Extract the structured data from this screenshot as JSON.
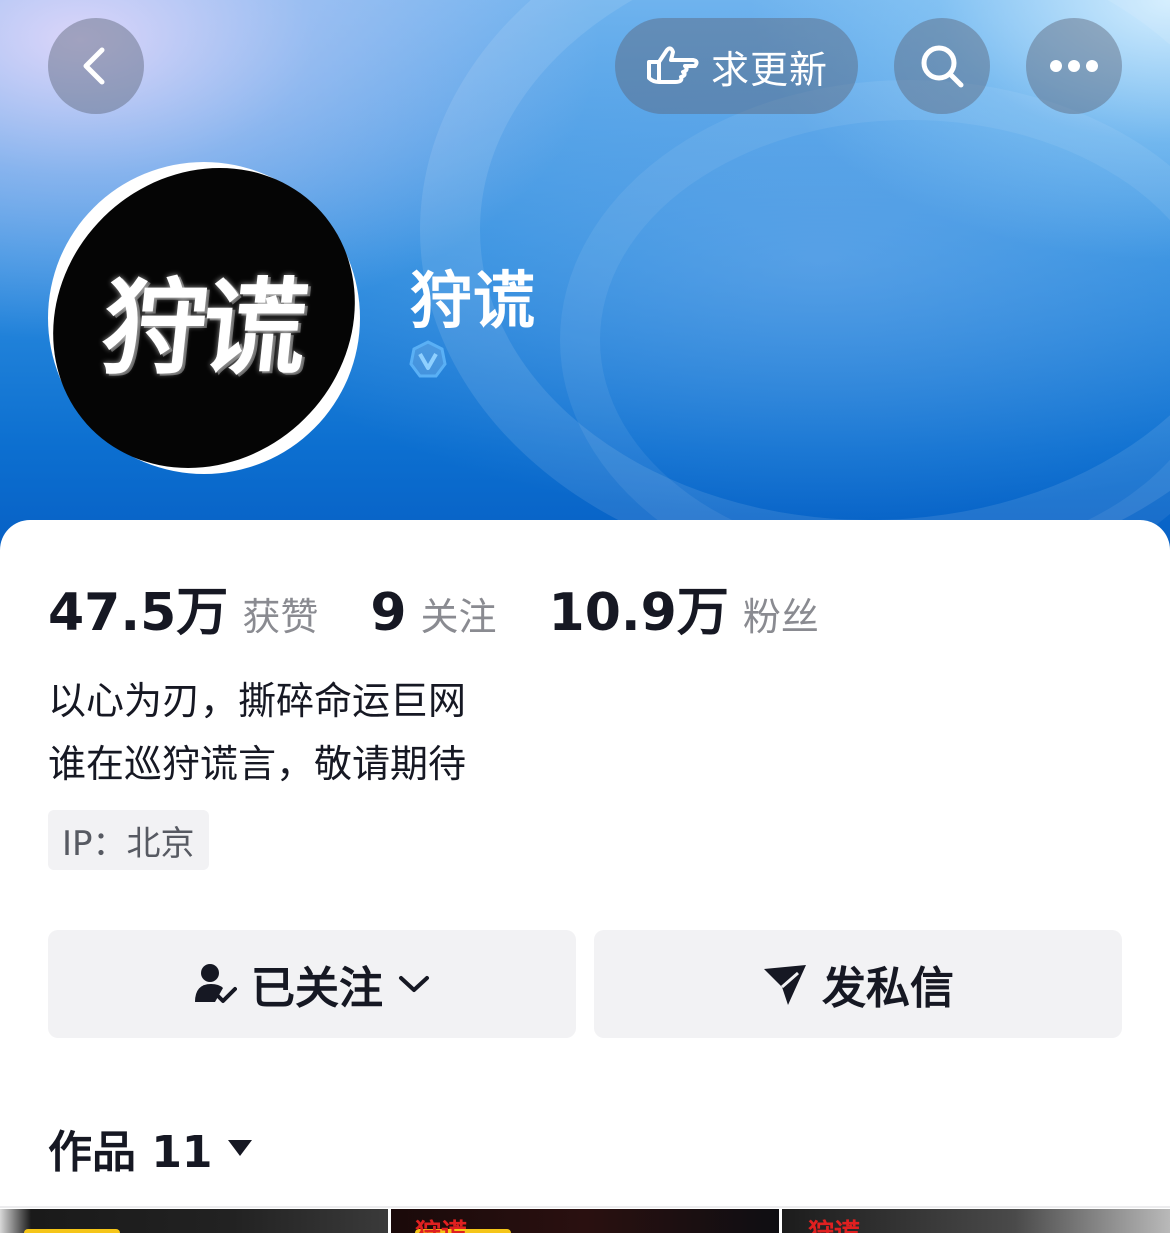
{
  "topbar": {
    "request_update_label": "求更新"
  },
  "profile": {
    "avatar_text": "狩谎",
    "name": "狩谎"
  },
  "stats": [
    {
      "value": "47.5万",
      "label": "获赞"
    },
    {
      "value": "9",
      "label": "关注"
    },
    {
      "value": "10.9万",
      "label": "粉丝"
    }
  ],
  "bio": {
    "line1": "以心为刃，撕碎命运巨网",
    "line2": "谁在巡狩谎言，敬请期待"
  },
  "ip": "IP：北京",
  "actions": {
    "follow_label": "已关注",
    "message_label": "发私信"
  },
  "works": {
    "label": "作品 11"
  },
  "thumbnails": [
    {
      "text": ""
    },
    {
      "text": "狩谎"
    },
    {
      "text": "狩谎"
    }
  ],
  "colors": {
    "header_blue": "#0c6fd0",
    "button_bg": "#f2f2f4",
    "muted_text": "#8a8b91"
  }
}
